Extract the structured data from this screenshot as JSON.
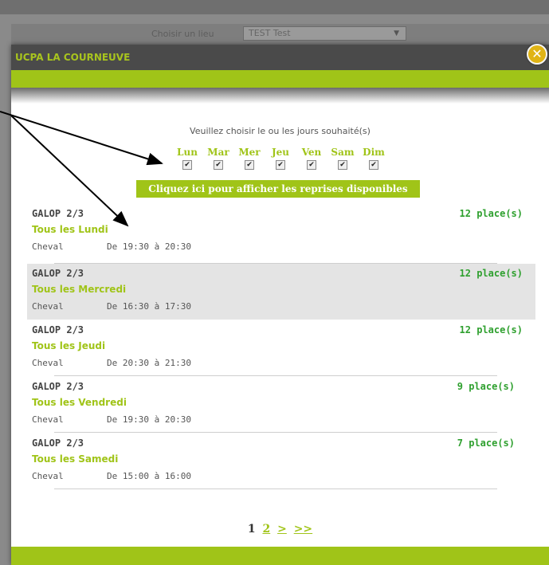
{
  "background": {
    "filter_label": "Choisir un lieu",
    "filter_value": "TEST Test"
  },
  "modal": {
    "title": "UCPA LA COURNEUVE",
    "close_glyph": "✕",
    "choose_label": "Veuillez choisir le ou les jours souhaité(s)",
    "days": [
      {
        "label": "Lun",
        "checked": true
      },
      {
        "label": "Mar",
        "checked": true
      },
      {
        "label": "Mer",
        "checked": true
      },
      {
        "label": "Jeu",
        "checked": true
      },
      {
        "label": "Ven",
        "checked": true
      },
      {
        "label": "Sam",
        "checked": true
      },
      {
        "label": "Dim",
        "checked": true
      }
    ],
    "check_glyph": "✔",
    "show_button": "Cliquez ici pour afficher les reprises disponibles",
    "slots": [
      {
        "level": "GALOP 2/3",
        "day": "Tous les Lundi",
        "type": "Cheval",
        "time": "De 19:30 à 20:30",
        "places": "12 place(s)"
      },
      {
        "level": "GALOP 2/3",
        "day": "Tous les Mercredi",
        "type": "Cheval",
        "time": "De 16:30 à 17:30",
        "places": "12 place(s)"
      },
      {
        "level": "GALOP 2/3",
        "day": "Tous les Jeudi",
        "type": "Cheval",
        "time": "De 20:30 à 21:30",
        "places": "12 place(s)"
      },
      {
        "level": "GALOP 2/3",
        "day": "Tous les Vendredi",
        "type": "Cheval",
        "time": "De 19:30 à 20:30",
        "places": "9 place(s)"
      },
      {
        "level": "GALOP 2/3",
        "day": "Tous les Samedi",
        "type": "Cheval",
        "time": "De 15:00 à 16:00",
        "places": "7 place(s)"
      }
    ],
    "pagination": {
      "current": "1",
      "page2": "2",
      "next": ">",
      "last": ">>"
    }
  },
  "colors": {
    "accent_green": "#a0c418",
    "places_green": "#2fa02f",
    "header_bg": "#4a4a4a",
    "close_yellow": "#e0b415"
  }
}
